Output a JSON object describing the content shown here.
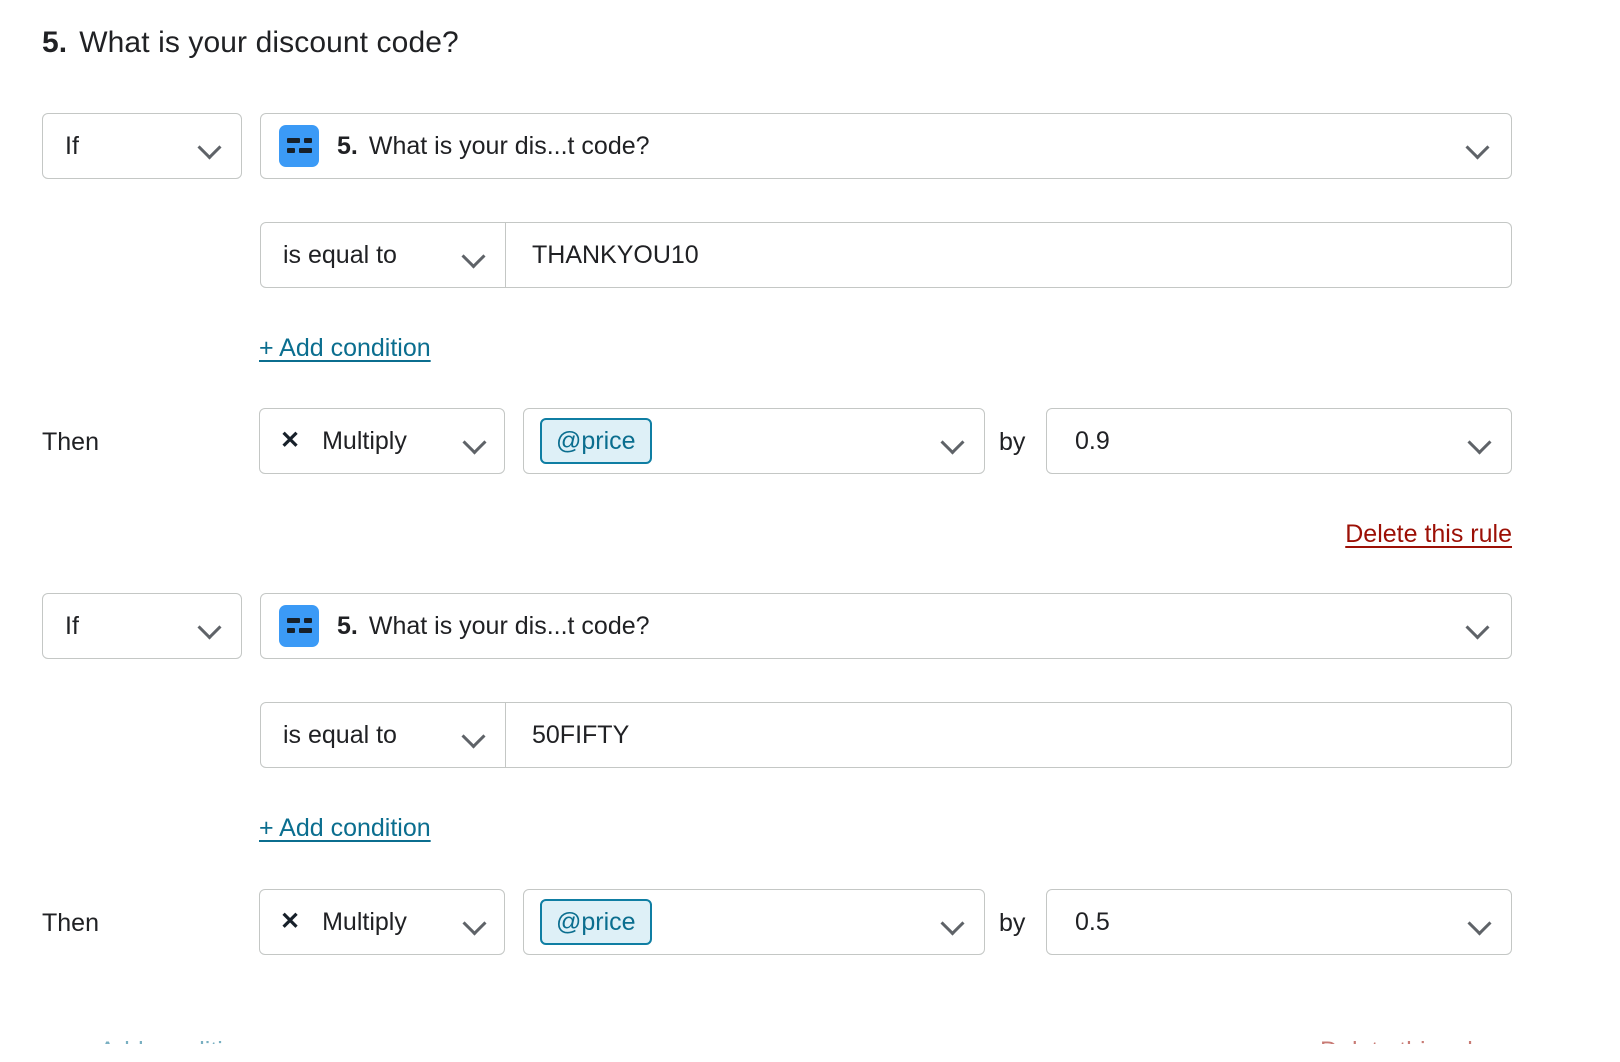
{
  "question": {
    "number": "5.",
    "title": "What is your discount code?"
  },
  "labels": {
    "then": "Then",
    "by": "by",
    "add_condition": "+ Add condition",
    "delete_rule": "Delete this rule"
  },
  "colors": {
    "link_teal": "#0b6e8f",
    "delete_red": "#9c1006",
    "icon_blue": "#3b9af6",
    "chip_bg": "#def0f7",
    "chip_border": "#0f7ea3",
    "border_grey": "#c4c7c5",
    "text_primary": "#202124"
  },
  "rules": [
    {
      "connector": "If",
      "question_icon": "short-answer-icon",
      "question_number": "5.",
      "question_label": "What is your dis...t code?",
      "operator": "is equal to",
      "value": "THANKYOU10",
      "add_condition": "+ Add condition",
      "then_label": "Then",
      "math_operator_glyph": "✕",
      "math_operator": "Multiply",
      "variable": "@price",
      "by_label": "by",
      "factor": "0.9",
      "delete_label": "Delete this rule"
    },
    {
      "connector": "If",
      "question_icon": "short-answer-icon",
      "question_number": "5.",
      "question_label": "What is your dis...t code?",
      "operator": "is equal to",
      "value": "50FIFTY",
      "add_condition": "+ Add condition",
      "then_label": "Then",
      "math_operator_glyph": "✕",
      "math_operator": "Multiply",
      "variable": "@price",
      "by_label": "by",
      "factor": "0.5",
      "delete_label": "Delete this rule"
    }
  ],
  "clipped": {
    "add_condition": "+ Add condition",
    "delete_rule": "Delete this rule"
  }
}
